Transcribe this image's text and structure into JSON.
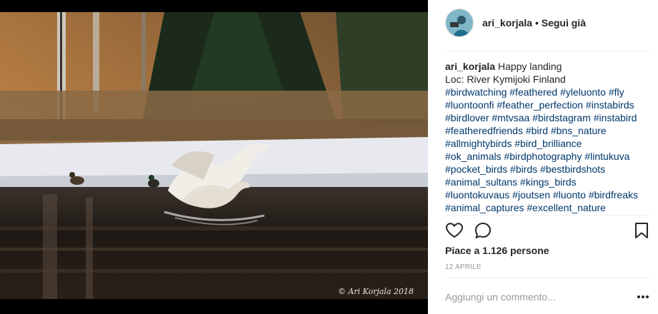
{
  "header": {
    "username": "ari_korjala",
    "separator": " • ",
    "follow_status": "Segui già",
    "avatar_icon": "profile-photo-avatar"
  },
  "photo": {
    "watermark": "© Ari Korjala 2018",
    "colors": {
      "water": "#211a16",
      "snow": "#e7e9ee",
      "grass": "#8a6a45",
      "trees": "#1d2a1c"
    }
  },
  "caption": {
    "username": "ari_korjala",
    "text": "Happy landing",
    "location": "Loc: River Kymijoki Finland",
    "tag_lines": [
      "#birdwatching #feathered #yleluonto #fly",
      "#luontoonfi #feather_perfection #instabirds",
      "#birdlover #mtvsaa #birdstagram #instabird",
      "#featheredfriends #bird #bns_nature",
      "#allmightybirds #bird_brilliance",
      "#ok_animals #birdphotography #lintukuva",
      "#pocket_birds #birds #bestbirdshots",
      "#animal_sultans #kings_birds",
      "#luontokuvaus #joutsen #luonto #birdfreaks",
      "#animal_captures #excellent_nature"
    ],
    "tag_color": "#003569"
  },
  "actions": {
    "like_icon": "heart-icon",
    "comment_icon": "speech-bubble-icon",
    "save_icon": "bookmark-icon"
  },
  "likes": "Piace a 1.126 persone",
  "date": "12 APRILE",
  "comment_box": {
    "placeholder": "Aggiungi un commento...",
    "more_icon": "more-options-icon"
  }
}
